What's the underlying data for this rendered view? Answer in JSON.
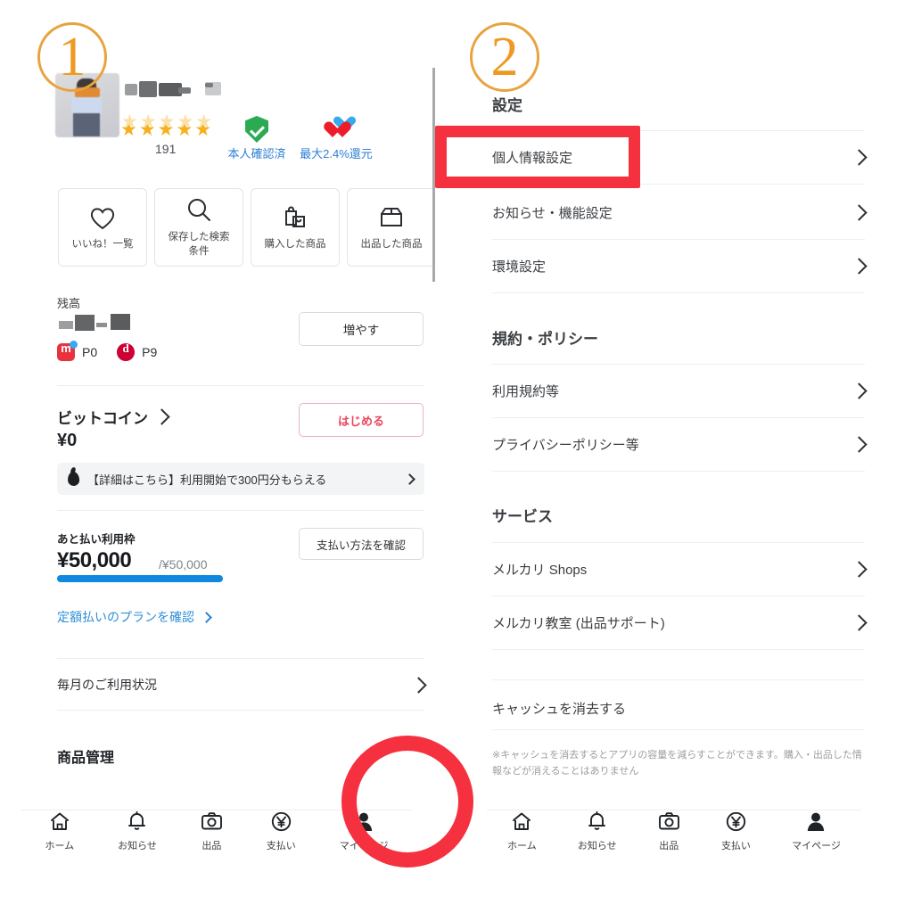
{
  "annotations": {
    "step1": "①",
    "step1_num": "1",
    "step2_num": "2",
    "step2_caption": "設定"
  },
  "left": {
    "profile": {
      "username_masked": "",
      "rating_count": "191",
      "stars": "★★★★★",
      "verified_label": "本人確認済",
      "cashback_label": "最大2.4%還元"
    },
    "tiles": [
      {
        "icon": "heart-icon",
        "label": "いいね！一覧"
      },
      {
        "icon": "search-icon",
        "label": "保存した検索\n条件",
        "line1": "保存した検索",
        "line2": "条件"
      },
      {
        "icon": "shopping-bag-icon",
        "label": "購入した商品"
      },
      {
        "icon": "box-icon",
        "label": "出品した商品"
      }
    ],
    "balance": {
      "section_label": "残高",
      "amount_masked": "",
      "add_button": "増やす",
      "points": [
        {
          "icon": "mercari-point-icon",
          "value": "P0"
        },
        {
          "icon": "dpoint-icon",
          "value": "P9"
        }
      ]
    },
    "bitcoin": {
      "title": "ビットコイン",
      "amount": "¥0",
      "start_button": "はじめる",
      "promo_text": "【詳細はこちら】利用開始で300円分もらえる"
    },
    "atobarai": {
      "label": "あと払い利用枠",
      "amount": "¥50,000",
      "max": "/¥50,000",
      "progress_percent": 100,
      "confirm_button": "支払い方法を確認",
      "plan_link": "定額払いのプランを確認"
    },
    "monthly_usage_row": "毎月のご利用状況",
    "item_management_head": "商品管理"
  },
  "right": {
    "settings_title": "設定",
    "settings_items": [
      {
        "label": "個人情報設定",
        "highlighted": true
      },
      {
        "label": "お知らせ・機能設定",
        "highlighted": false
      },
      {
        "label": "環境設定",
        "highlighted": false
      }
    ],
    "policy_head": "規約・ポリシー",
    "policy_items": [
      {
        "label": "利用規約等"
      },
      {
        "label": "プライバシーポリシー等"
      }
    ],
    "service_head": "サービス",
    "service_items": [
      {
        "label": "メルカリ Shops"
      },
      {
        "label": "メルカリ教室 (出品サポート)"
      }
    ],
    "cache_row": "キャッシュを消去する",
    "cache_note": "※キャッシュを消去するとアプリの容量を減らすことができます。購入・出品した情報などが消えることはありません"
  },
  "bottom_nav": [
    {
      "icon": "home-icon",
      "label": "ホーム"
    },
    {
      "icon": "bell-icon",
      "label": "お知らせ"
    },
    {
      "icon": "camera-icon",
      "label": "出品"
    },
    {
      "icon": "yen-icon",
      "label": "支払い"
    },
    {
      "icon": "person-icon",
      "label": "マイページ"
    }
  ],
  "colors": {
    "annotation_red": "#f5313f",
    "annotation_orange": "#ef9922",
    "link_blue": "#2c8fd6",
    "progress_blue": "#0f88e0",
    "accent_red": "#e8465c",
    "verified_green": "#2aab52"
  }
}
